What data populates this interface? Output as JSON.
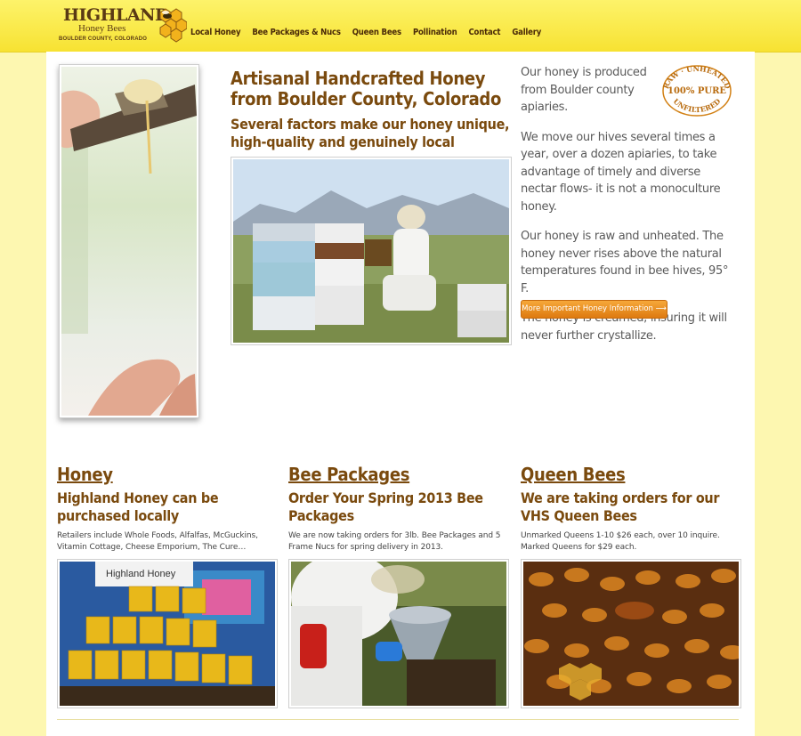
{
  "brand": {
    "line1": "HIGHLAND",
    "line2": "Honey Bees",
    "line3": "BOULDER COUNTY, COLORADO",
    "icon": "honeycomb-bee-icon"
  },
  "nav": [
    {
      "label": "Local Honey"
    },
    {
      "label": "Bee Packages & Nucs"
    },
    {
      "label": "Queen Bees"
    },
    {
      "label": "Pollination"
    },
    {
      "label": "Contact"
    },
    {
      "label": "Gallery"
    }
  ],
  "hero": {
    "title": "Artisanal Handcrafted Honey from Boulder County, Colorado",
    "subtitle": "Several factors make our honey unique, high-quality and genuinely local"
  },
  "seal": {
    "top": "RAW · UNHEATED",
    "center": "100% PURE",
    "bottom": "UNFILTERED"
  },
  "about": {
    "p1": "Our honey is produced from Boulder county apiaries.",
    "p2": "We move our hives several times a year, over a dozen apiaries, to take advantage of timely and diverse nectar flows- it is not a monoculture honey.",
    "p3": "Our honey is raw and unheated. The honey never rises above the natural temperatures found in bee hives, 95° F.",
    "p4": "The honey is creamed, insuring it will never further crystallize.",
    "button": "More Important Honey Information ⟶"
  },
  "columns": [
    {
      "title": "Honey",
      "subtitle": "Highland Honey can be purchased locally",
      "desc": "Retailers include Whole Foods, Alfalfas, McGuckins, Vitamin Cottage, Cheese Emporium, The Cure…",
      "image_label": "Highland Honey"
    },
    {
      "title": "Bee Packages",
      "subtitle": "Order Your Spring 2013 Bee Packages",
      "desc": "We are now taking orders for 3lb. Bee Packages and 5 Frame Nucs for spring delivery in 2013."
    },
    {
      "title": "Queen Bees",
      "subtitle": "We are taking orders for our VHS Queen Bees",
      "desc": "Unmarked Queens 1-10 $26 each, over 10 inquire. Marked Queens for $29 each."
    }
  ],
  "colors": {
    "header": "#fbe94a",
    "page_bg": "#fdf7b0",
    "heading": "#7a4a0e",
    "button": "#e8891e"
  }
}
